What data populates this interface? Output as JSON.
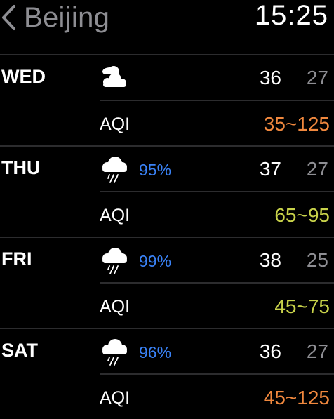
{
  "header": {
    "city": "Beijing",
    "time": "15:25"
  },
  "colors": {
    "aqi_orange": "#f0883e",
    "aqi_yellow": "#c8d24a",
    "precip_blue": "#3a82f6"
  },
  "days": [
    {
      "name": "WED",
      "icon": "partly-cloudy-icon",
      "precip": "",
      "high": "36",
      "low": "27",
      "aqi_label": "AQI",
      "aqi": "35~125",
      "aqi_color": "#f0883e"
    },
    {
      "name": "THU",
      "icon": "rain-cloud-icon",
      "precip": "95%",
      "high": "37",
      "low": "27",
      "aqi_label": "AQI",
      "aqi": "65~95",
      "aqi_color": "#c8d24a"
    },
    {
      "name": "FRI",
      "icon": "rain-cloud-icon",
      "precip": "99%",
      "high": "38",
      "low": "25",
      "aqi_label": "AQI",
      "aqi": "45~75",
      "aqi_color": "#c8d24a"
    },
    {
      "name": "SAT",
      "icon": "rain-cloud-icon",
      "precip": "96%",
      "high": "36",
      "low": "27",
      "aqi_label": "AQI",
      "aqi": "45~125",
      "aqi_color": "#f0883e"
    }
  ]
}
